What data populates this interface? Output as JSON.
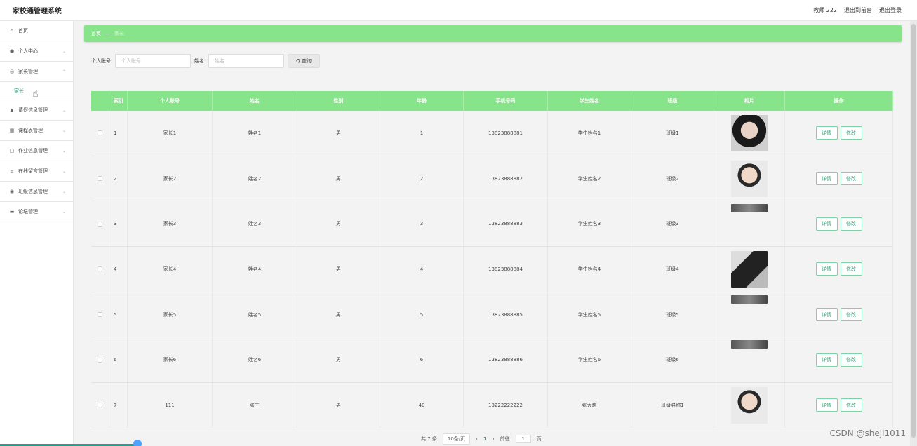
{
  "app": {
    "title": "家校通管理系统"
  },
  "header": {
    "user": "教师 222",
    "front": "退出到前台",
    "logout": "退出登录"
  },
  "sidebar": {
    "items": [
      {
        "icon": "home-icon",
        "glyph": "⌂",
        "label": "首页"
      },
      {
        "icon": "user-icon",
        "glyph": "●",
        "label": "个人中心",
        "chevron": "⌄"
      },
      {
        "icon": "settings-icon",
        "glyph": "◎",
        "label": "家长管理",
        "chevron": "⌃"
      },
      {
        "icon": "leave-icon",
        "glyph": "▲",
        "label": "请假信息管理",
        "chevron": "⌄"
      },
      {
        "icon": "table-icon",
        "glyph": "▦",
        "label": "课程表管理",
        "chevron": "⌄"
      },
      {
        "icon": "task-icon",
        "glyph": "▢",
        "label": "作业信息管理",
        "chevron": "⌄"
      },
      {
        "icon": "list-icon",
        "glyph": "≡",
        "label": "在线留言管理",
        "chevron": "⌄"
      },
      {
        "icon": "circle-icon",
        "glyph": "◉",
        "label": "班级信息管理",
        "chevron": "⌄"
      },
      {
        "icon": "forum-icon",
        "glyph": "▬",
        "label": "论坛管理",
        "chevron": "⌄"
      }
    ],
    "sub_active": "家长"
  },
  "breadcrumb": {
    "home": "首页",
    "sep": "—",
    "current": "家长"
  },
  "search": {
    "account_label": "个人账号",
    "account_placeholder": "个人账号",
    "name_label": "姓名",
    "name_placeholder": "姓名",
    "button": "Q 查询"
  },
  "table": {
    "headers": [
      "",
      "索引",
      "个人账号",
      "姓名",
      "性别",
      "年龄",
      "手机号码",
      "学生姓名",
      "班级",
      "相片",
      "操作"
    ],
    "rows": [
      {
        "idx": "1",
        "account": "家长1",
        "name": "姓名1",
        "sex": "男",
        "age": "1",
        "phone": "13823888881",
        "student": "学生姓名1",
        "class": "班级1",
        "photo": "female"
      },
      {
        "idx": "2",
        "account": "家长2",
        "name": "姓名2",
        "sex": "男",
        "age": "2",
        "phone": "13823888882",
        "student": "学生姓名2",
        "class": "班级2",
        "photo": "male"
      },
      {
        "idx": "3",
        "account": "家长3",
        "name": "姓名3",
        "sex": "男",
        "age": "3",
        "phone": "13823888883",
        "student": "学生姓名3",
        "class": "班级3",
        "photo": "partial"
      },
      {
        "idx": "4",
        "account": "家长4",
        "name": "姓名4",
        "sex": "男",
        "age": "4",
        "phone": "13823888884",
        "student": "学生姓名4",
        "class": "班级4",
        "photo": "dark"
      },
      {
        "idx": "5",
        "account": "家长5",
        "name": "姓名5",
        "sex": "男",
        "age": "5",
        "phone": "13823888885",
        "student": "学生姓名5",
        "class": "班级5",
        "photo": "partial"
      },
      {
        "idx": "6",
        "account": "家长6",
        "name": "姓名6",
        "sex": "男",
        "age": "6",
        "phone": "13823888886",
        "student": "学生姓名6",
        "class": "班级6",
        "photo": "partial"
      },
      {
        "idx": "7",
        "account": "111",
        "name": "张三",
        "sex": "男",
        "age": "40",
        "phone": "13222222222",
        "student": "张大炮",
        "class": "班级名称1",
        "photo": "male"
      }
    ],
    "detail_label": "详情",
    "edit_label": "修改"
  },
  "pager": {
    "total": "共 7 条",
    "size": "10条/页",
    "prev": "‹",
    "page": "1",
    "next": "›",
    "goto": "前往",
    "goto_value": "1",
    "unit": "页"
  },
  "watermark": "CSDN @sheji1011",
  "colors": {
    "accent": "#88e48a",
    "text_green": "#2f9e72"
  }
}
